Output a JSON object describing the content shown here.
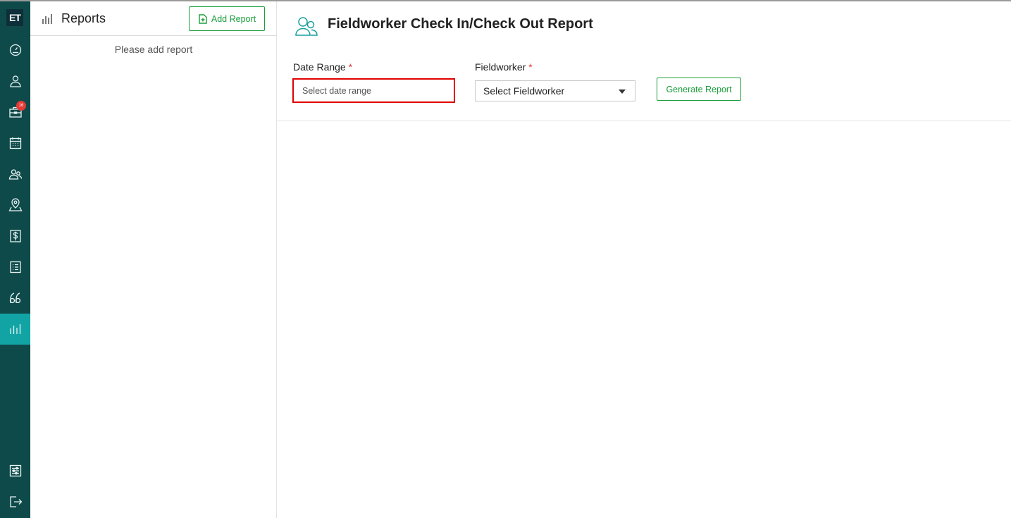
{
  "sidebar": {
    "logo_text": "ET",
    "badge_count": "16",
    "items": [
      {
        "icon": "dashboard-icon"
      },
      {
        "icon": "user-icon"
      },
      {
        "icon": "briefcase-icon"
      },
      {
        "icon": "calendar-icon"
      },
      {
        "icon": "team-icon"
      },
      {
        "icon": "map-pin-icon"
      },
      {
        "icon": "dollar-icon"
      },
      {
        "icon": "list-icon"
      },
      {
        "icon": "quote-icon"
      },
      {
        "icon": "reports-icon",
        "active": true
      },
      {
        "icon": "settings-sliders-icon"
      },
      {
        "icon": "logout-icon"
      }
    ],
    "active_color": "#12a4a4",
    "background": "#0f4a4a"
  },
  "reports_panel": {
    "title": "Reports",
    "add_button_label": "Add Report",
    "empty_message": "Please add report"
  },
  "main": {
    "page_title": "Fieldworker Check In/Check Out Report",
    "form": {
      "date_range_label": "Date Range",
      "date_range_placeholder": "Select date range",
      "fieldworker_label": "Fieldworker",
      "fieldworker_selected": "Select Fieldworker",
      "required_marker": "*",
      "generate_button_label": "Generate Report"
    }
  },
  "colors": {
    "accent_green": "#1a9e3a",
    "required_red": "#e53935",
    "highlight_red": "#e00000"
  }
}
